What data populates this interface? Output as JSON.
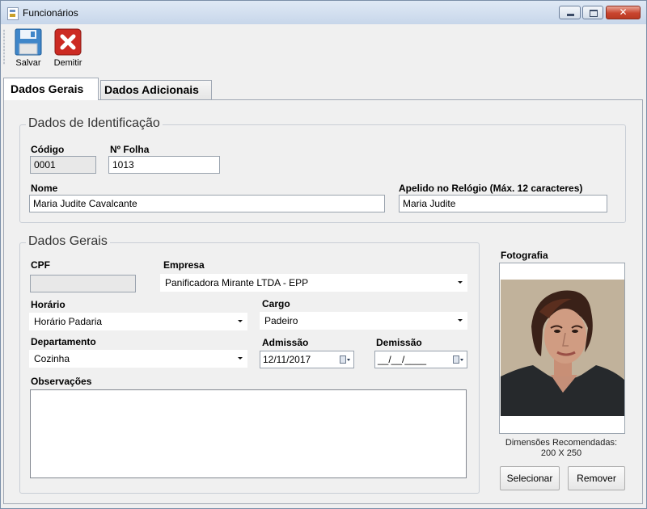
{
  "window": {
    "title": "Funcionários"
  },
  "toolbar": {
    "save_label": "Salvar",
    "fire_label": "Demitir"
  },
  "tabs": [
    {
      "label": "Dados Gerais"
    },
    {
      "label": "Dados Adicionais"
    }
  ],
  "identification": {
    "title": "Dados de Identificação",
    "codigo_label": "Código",
    "codigo_value": "0001",
    "folha_label": "Nº Folha",
    "folha_value": "1013",
    "nome_label": "Nome",
    "nome_value": "Maria Judite Cavalcante",
    "apelido_label": "Apelido no Relógio (Máx. 12 caracteres)",
    "apelido_value": "Maria Judite"
  },
  "general": {
    "title": "Dados Gerais",
    "cpf_label": "CPF",
    "cpf_value": "",
    "empresa_label": "Empresa",
    "empresa_value": "Panificadora Mirante LTDA - EPP",
    "horario_label": "Horário",
    "horario_value": "Horário Padaria",
    "cargo_label": "Cargo",
    "cargo_value": "Padeiro",
    "departamento_label": "Departamento",
    "departamento_value": "Cozinha",
    "admissao_label": "Admissão",
    "admissao_value": "12/11/2017",
    "demissao_label": "Demissão",
    "demissao_value": "__/__/____",
    "obs_label": "Observações",
    "obs_value": ""
  },
  "photo": {
    "label": "Fotografia",
    "hint_line1": "Dimensões Recomendadas:",
    "hint_line2": "200 X 250",
    "select_label": "Selecionar",
    "remove_label": "Remover"
  },
  "colors": {
    "save_icon": "#3f86c9",
    "fire_icon": "#cc2a22",
    "close_button": "#c9452f"
  }
}
